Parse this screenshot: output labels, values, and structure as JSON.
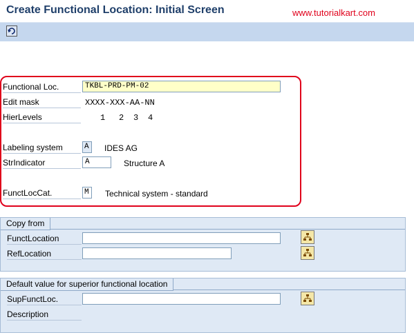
{
  "screen": {
    "title": "Create Functional Location: Initial Screen",
    "watermark": "www.tutorialkart.com"
  },
  "toolbar": {
    "icon": "refresh-icon"
  },
  "main": {
    "functional_loc_label": "Functional Loc.",
    "functional_loc_value": "TKBL-PRD-PM-02",
    "edit_mask_label": "Edit mask",
    "edit_mask_value": "XXXX-XXX-AA-NN",
    "hier_levels_label": "HierLevels",
    "hier_levels_values": [
      "1",
      "2",
      "3",
      "4"
    ],
    "labeling_system_label": "Labeling system",
    "labeling_system_value": "A",
    "labeling_system_text": "IDES AG",
    "str_indicator_label": "StrIndicator",
    "str_indicator_value": "A",
    "str_indicator_text": "Structure A",
    "funct_loc_cat_label": "FunctLocCat.",
    "funct_loc_cat_value": "M",
    "funct_loc_cat_text": "Technical system - standard"
  },
  "copy_from": {
    "title": "Copy from",
    "funct_location_label": "FunctLocation",
    "funct_location_value": "",
    "ref_location_label": "RefLocation",
    "ref_location_value": ""
  },
  "superior": {
    "title": "Default value for superior functional location",
    "sup_funct_loc_label": "SupFunctLoc.",
    "sup_funct_loc_value": "",
    "description_label": "Description"
  }
}
